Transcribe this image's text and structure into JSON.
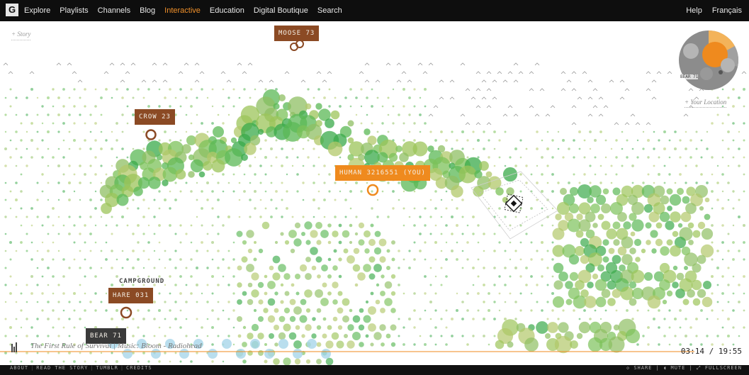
{
  "nav": {
    "logo": "G",
    "items": [
      {
        "label": "Explore",
        "active": false
      },
      {
        "label": "Playlists",
        "active": false
      },
      {
        "label": "Channels",
        "active": false
      },
      {
        "label": "Blog",
        "active": false
      },
      {
        "label": "Interactive",
        "active": true
      },
      {
        "label": "Education",
        "active": false
      },
      {
        "label": "Digital Boutique",
        "active": false
      },
      {
        "label": "Search",
        "active": false
      }
    ],
    "right": [
      "Help",
      "Français"
    ]
  },
  "story_link": "+ Story",
  "tags": {
    "moose": "MOOSE 73",
    "crow": "CROW 23",
    "human": "HUMAN 3216551 (YOU)",
    "hare": "HARE 031",
    "bear": "BEAR 71"
  },
  "place_label": "CAMPGROUND",
  "your_location": "+ Your Location",
  "minimap_label": "BEAR 71",
  "caption": "The First Rule of Survival | Music: Bloom - Radiohead",
  "playback": {
    "current": "03:14",
    "total": "19:55",
    "progress": 0.163
  },
  "bottom_left": [
    "ABOUT",
    "READ THE STORY",
    "TUMBLR",
    "CREDITS"
  ],
  "bottom_right": [
    "SHARE",
    "MUTE",
    "FULLSCREEN"
  ],
  "colors": {
    "accent": "#ef8a1e",
    "tag_brown": "#8b4a24",
    "green_dark": "#3aaa4a",
    "green_light": "#a9c457",
    "cyan": "#a8d6ea"
  },
  "icons": [
    "logo-icon",
    "camera-trap-icon",
    "equalizer-icon",
    "share-icon",
    "mute-icon",
    "fullscreen-icon"
  ]
}
